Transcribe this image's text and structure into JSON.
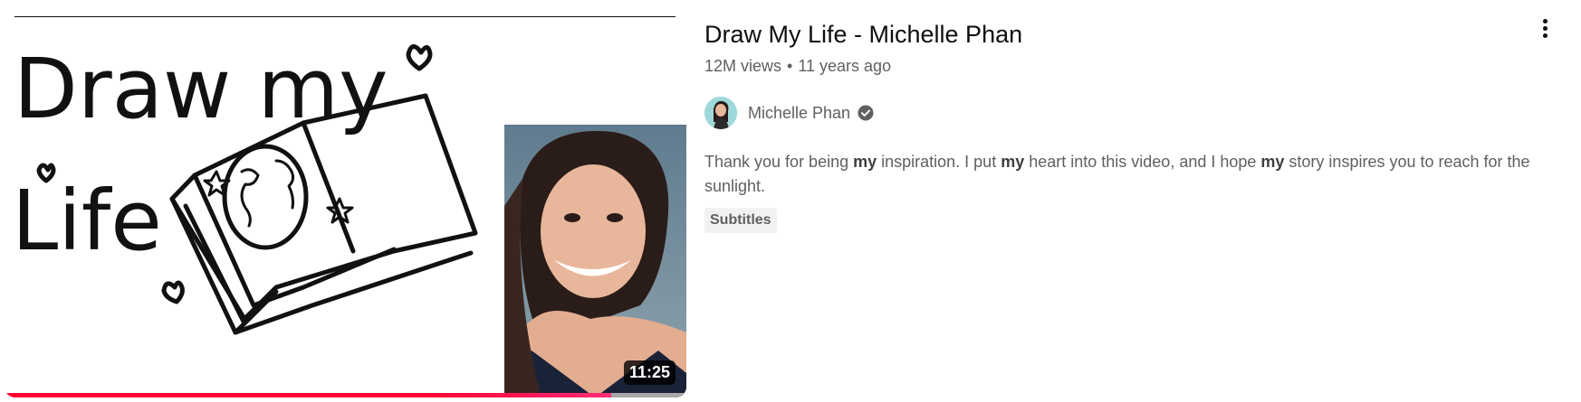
{
  "video": {
    "title": "Draw My Life - Michelle Phan",
    "views": "12M views",
    "separator": "•",
    "age": "11 years ago",
    "duration": "11:25",
    "watch_progress_percent": 89,
    "channel": {
      "name": "Michelle Phan",
      "verified": true,
      "verified_icon": "verified-check-icon"
    },
    "description": {
      "segments": [
        {
          "text": "Thank you for being ",
          "bold": false
        },
        {
          "text": "my",
          "bold": true
        },
        {
          "text": " inspiration. I put ",
          "bold": false
        },
        {
          "text": "my",
          "bold": true
        },
        {
          "text": " heart into this video, and I hope ",
          "bold": false
        },
        {
          "text": "my",
          "bold": true
        },
        {
          "text": " story inspires you to reach for the sunlight.",
          "bold": false
        }
      ]
    },
    "badge": "Subtitles",
    "thumbnail_text": {
      "line1": "Draw my",
      "line2": "Life"
    },
    "menu_icon": "more-vert-icon",
    "colors": {
      "progress": "#ff0033",
      "meta_text": "#606060",
      "title_text": "#0f0f0f"
    }
  }
}
